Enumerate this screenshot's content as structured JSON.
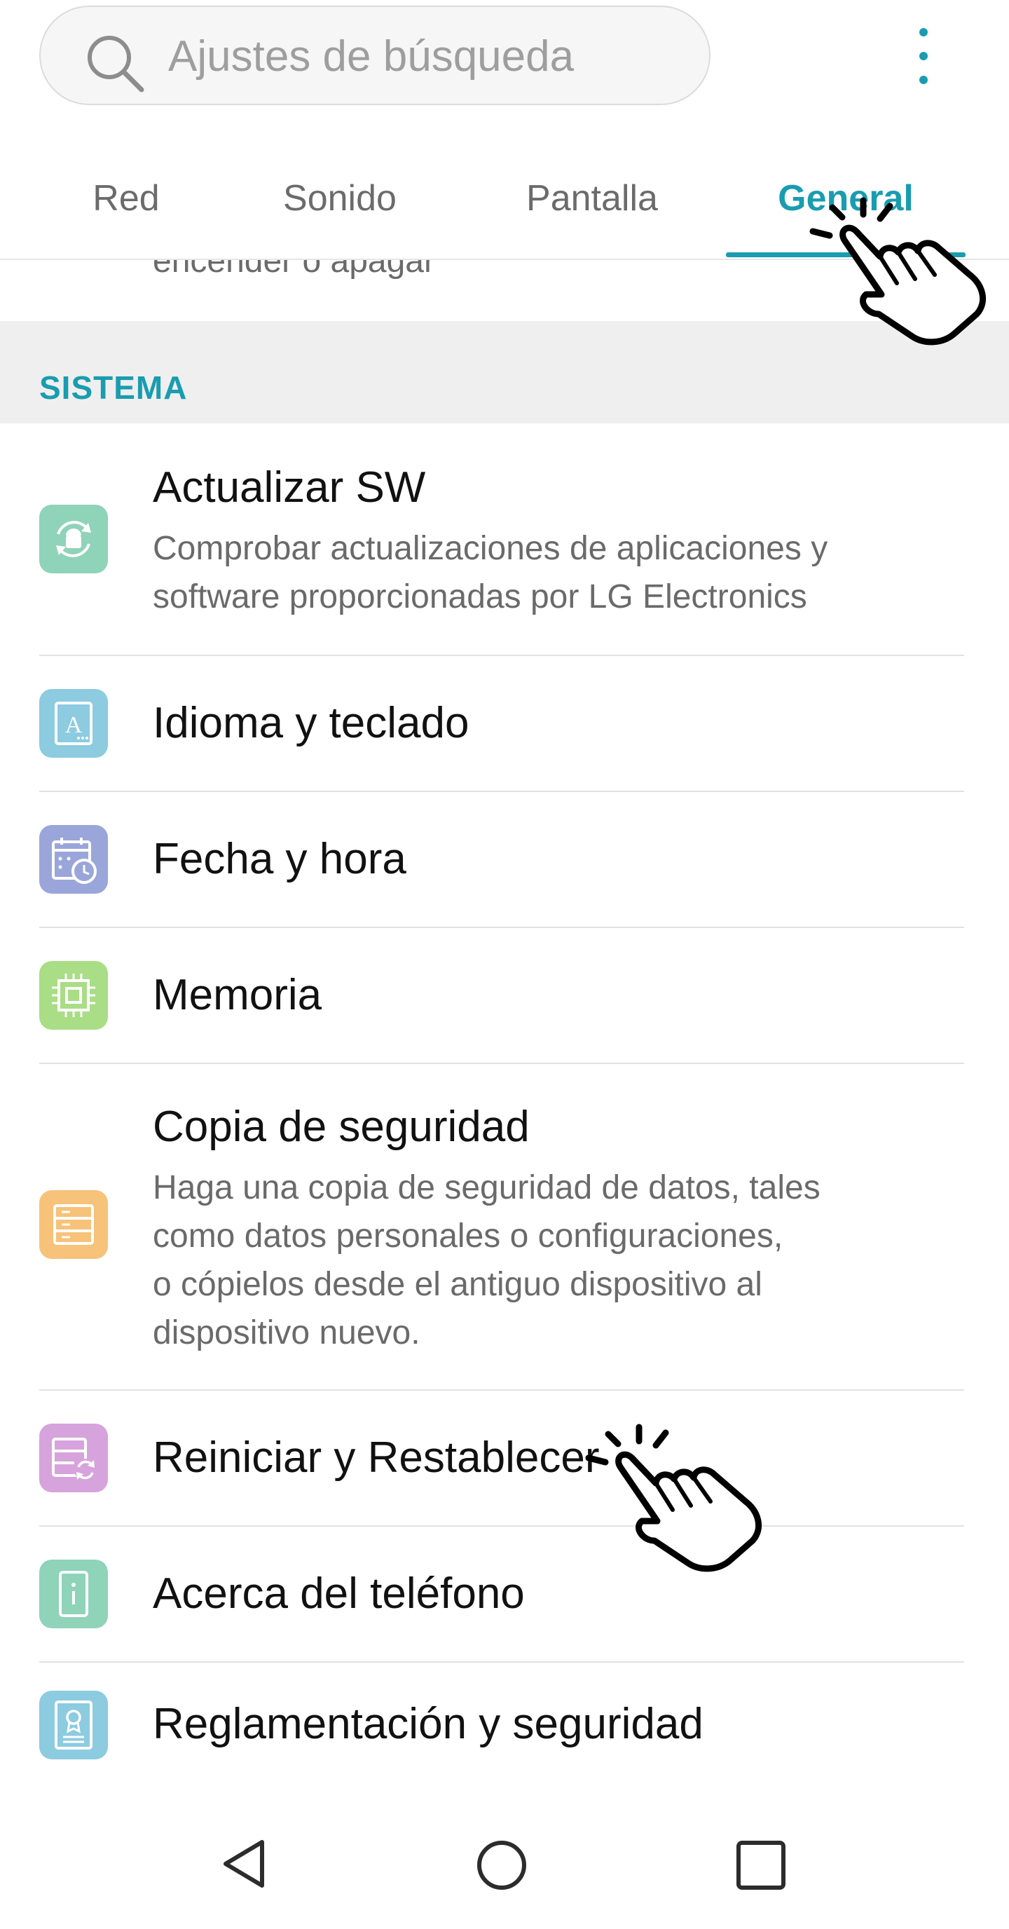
{
  "search": {
    "placeholder": "Ajustes de búsqueda"
  },
  "tabs": [
    {
      "label": "Red"
    },
    {
      "label": "Sonido"
    },
    {
      "label": "Pantalla"
    },
    {
      "label": "General",
      "active": true
    }
  ],
  "previous_item_desc_tail": "encender o apagar",
  "section": {
    "label": "SISTEMA"
  },
  "items": [
    {
      "title": "Actualizar SW",
      "description_lines": [
        "Comprobar actualizaciones de aplicaciones y",
        "software proporcionadas por LG Electronics"
      ],
      "icon": "software-update-icon",
      "color": "#8fd3b9"
    },
    {
      "title": "Idioma y teclado",
      "icon": "language-keyboard-icon",
      "color": "#8ccbe0"
    },
    {
      "title": "Fecha y hora",
      "icon": "calendar-clock-icon",
      "color": "#9aa6da"
    },
    {
      "title": "Memoria",
      "icon": "memory-chip-icon",
      "color": "#a9dd86"
    },
    {
      "title": "Copia de seguridad",
      "description_lines": [
        "Haga una copia de seguridad de datos, tales",
        "como datos personales o configuraciones,",
        "o cópielos desde el antiguo dispositivo al",
        "dispositivo nuevo."
      ],
      "icon": "backup-icon",
      "color": "#f7c27a"
    },
    {
      "title": "Reiniciar y Restablecer",
      "icon": "reset-icon",
      "color": "#d7a3dc"
    },
    {
      "title": "Acerca del teléfono",
      "icon": "info-icon",
      "color": "#8fd3b9"
    },
    {
      "title": "Reglamentación y seguridad",
      "icon": "certificate-icon",
      "color": "#8ccbe0"
    }
  ],
  "colors": {
    "accent": "#1a9cb0",
    "section_bg": "#efefef"
  },
  "navigation": [
    "back-icon",
    "home-icon",
    "recents-icon"
  ]
}
